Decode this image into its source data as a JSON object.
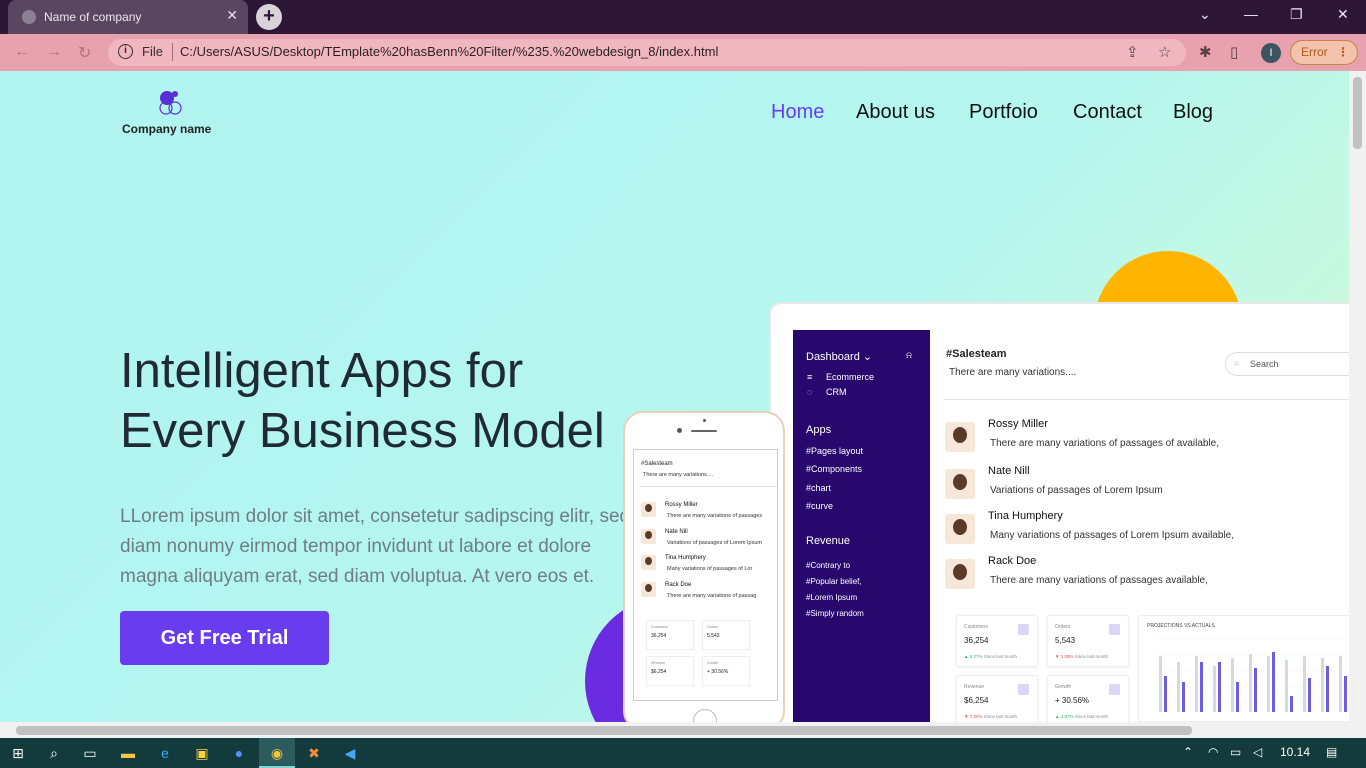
{
  "browser": {
    "tab_title": "Name of company",
    "tab_close": "✕",
    "new_tab": "+",
    "file_label": "File",
    "url": "C:/Users/ASUS/Desktop/TEmplate%20hasBenn%20Filter/%235.%20webdesign_8/index.html",
    "profile_initial": "I",
    "error_label": "Error",
    "error_menu": "⋮",
    "win_minimize": "—",
    "win_restore": "❐",
    "win_close": "✕",
    "tab_search": "⌄"
  },
  "site": {
    "company_name": "Company name",
    "nav": [
      "Home",
      "About us",
      "Portfoio",
      "Contact",
      "Blog"
    ],
    "hero_title_line1": "Intelligent Apps for",
    "hero_title_line2": "Every Business Model",
    "hero_text_line1": "LLorem ipsum dolor sit amet, consetetur sadipscing elitr, sed",
    "hero_text_line2": "diam nonumy eirmod tempor invidunt ut labore et dolore",
    "hero_text_line3": "magna aliquyam erat, sed diam voluptua. At vero eos et.",
    "cta": "Get Free Trial",
    "colors": {
      "accent": "#6a3cf0",
      "sun": "#ffb400",
      "sidebar": "#29086e"
    }
  },
  "dashboard": {
    "side_title": "Dashboard ⌄",
    "side_bell": "🔔",
    "side_items_top": [
      "Ecommerce",
      "CRM"
    ],
    "apps_heading": "Apps",
    "apps_items": [
      "#Pages layout",
      "#Components",
      "#chart",
      "#curve"
    ],
    "revenue_heading": "Revenue",
    "revenue_items": [
      "#Contrary to",
      "#Popular belief,",
      "#Lorem Ipsum",
      "#Simply random"
    ],
    "title": "#Salesteam",
    "subtitle": "There are many variations....",
    "search_placeholder": "Search",
    "people": [
      {
        "name": "Rossy Miller",
        "desc": "There are many variations of passages of available,"
      },
      {
        "name": "Nate Nill",
        "desc": "Variations of passages of Lorem Ipsum"
      },
      {
        "name": "Tina Humphery",
        "desc": "Many variations of passages of Lorem Ipsum available,"
      },
      {
        "name": "Rack Doe",
        "desc": "There are many variations of passages available,"
      }
    ],
    "stats": [
      {
        "label": "Customers",
        "value": "36,254",
        "change": "▲ 5.27%",
        "since": "Since last month"
      },
      {
        "label": "Orders",
        "value": "5,543",
        "change": "▼ 1.08%",
        "since": "Since last month"
      },
      {
        "label": "Revenue",
        "value": "$6,254",
        "change": "▼ 7.00%",
        "since": "Since last month"
      },
      {
        "label": "Growth",
        "value": "+ 30.56%",
        "change": "▲ 4.87%",
        "since": "Since last month"
      }
    ],
    "projections_title": "PROJECTIONS VS ACTUALS"
  },
  "phone": {
    "title": "#Salesteam",
    "subtitle": "There are many variations....",
    "people": [
      {
        "name": "Rossy Miller",
        "desc": "There are many variations of passages"
      },
      {
        "name": "Nate Nill",
        "desc": "Variations of passages of Lorem Ipsum"
      },
      {
        "name": "Tina Humphery",
        "desc": "Many variations of passages of Lor"
      },
      {
        "name": "Rack Doe",
        "desc": "There are many variations of passag"
      }
    ],
    "stats": [
      {
        "label": "Customers",
        "value": "36,254"
      },
      {
        "label": "Orders",
        "value": "5,543"
      },
      {
        "label": "Revenue",
        "value": "$6,254"
      },
      {
        "label": "Growth",
        "value": "+ 30.56%"
      }
    ]
  },
  "taskbar": {
    "time": "10.14"
  }
}
